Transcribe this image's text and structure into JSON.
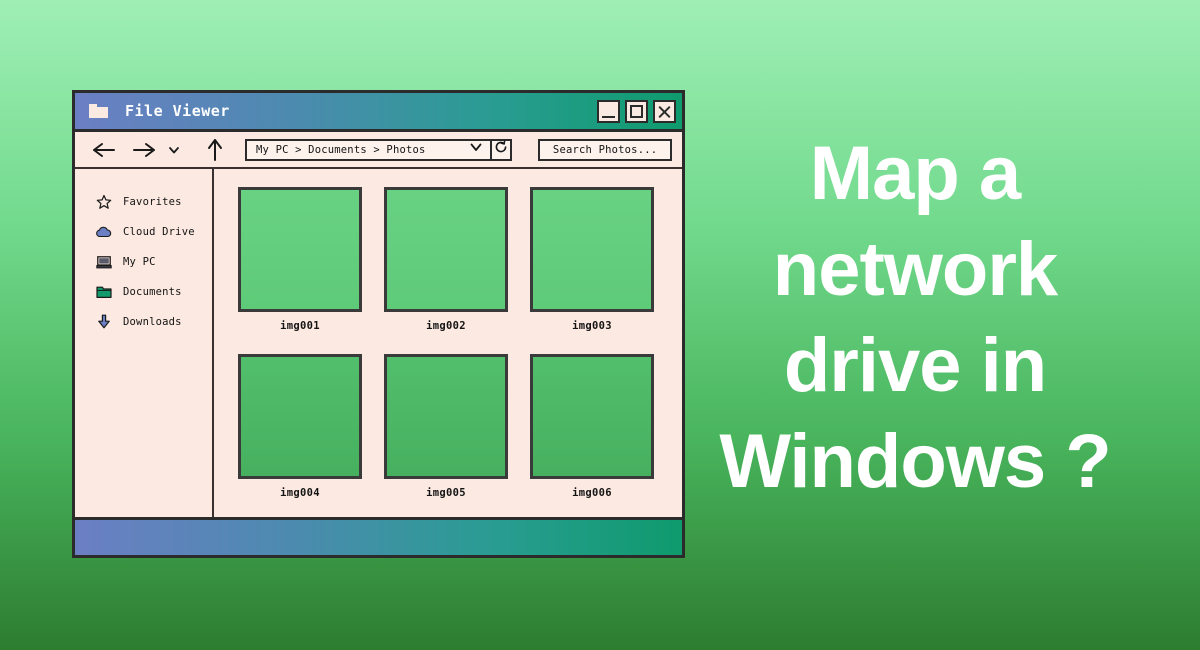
{
  "window": {
    "title": "File Viewer",
    "title_icon": "folder-icon",
    "controls": [
      {
        "name": "minimize",
        "glyph": "_"
      },
      {
        "name": "maximize",
        "glyph": "square"
      },
      {
        "name": "close",
        "glyph": "X"
      }
    ]
  },
  "toolbar": {
    "nav": [
      {
        "name": "back",
        "icon": "arrow-left-icon"
      },
      {
        "name": "forward",
        "icon": "arrow-right-icon"
      },
      {
        "name": "history",
        "icon": "chevron-down-icon"
      },
      {
        "name": "up",
        "icon": "arrow-up-icon"
      }
    ],
    "address": {
      "value": "My PC > Documents > Photos",
      "dropdown_icon": "chevron-down-icon",
      "refresh_icon": "refresh-icon"
    },
    "search": {
      "placeholder": "Search Photos...",
      "value": "Search Photos..."
    }
  },
  "sidebar": {
    "items": [
      {
        "label": "Favorites",
        "icon": "star-icon"
      },
      {
        "label": "Cloud Drive",
        "icon": "cloud-icon"
      },
      {
        "label": "My PC",
        "icon": "monitor-icon"
      },
      {
        "label": "Documents",
        "icon": "folder-icon"
      },
      {
        "label": "Downloads",
        "icon": "download-arrow-icon"
      }
    ]
  },
  "content": {
    "rows": [
      [
        {
          "label": "img001"
        },
        {
          "label": "img002"
        },
        {
          "label": "img003"
        }
      ],
      [
        {
          "label": "img004"
        },
        {
          "label": "img005"
        },
        {
          "label": "img006"
        }
      ]
    ]
  },
  "statusbar": {
    "text": ""
  },
  "headline": {
    "lines": [
      "Map a",
      "network",
      "drive in",
      "Windows ?"
    ]
  },
  "colors": {
    "background_top": "#9fefb5",
    "background_bottom": "#2d7d2f",
    "panel": "#fce9e1",
    "titlebar_start": "#6b7fc4",
    "titlebar_end": "#0f9b6d",
    "border": "#2b2b2b",
    "headline_text": "#ffffff",
    "folder_icon": "#119a6b",
    "cloud_icon": "#6b7fc4",
    "thumb_border": "#3a3a3a"
  }
}
